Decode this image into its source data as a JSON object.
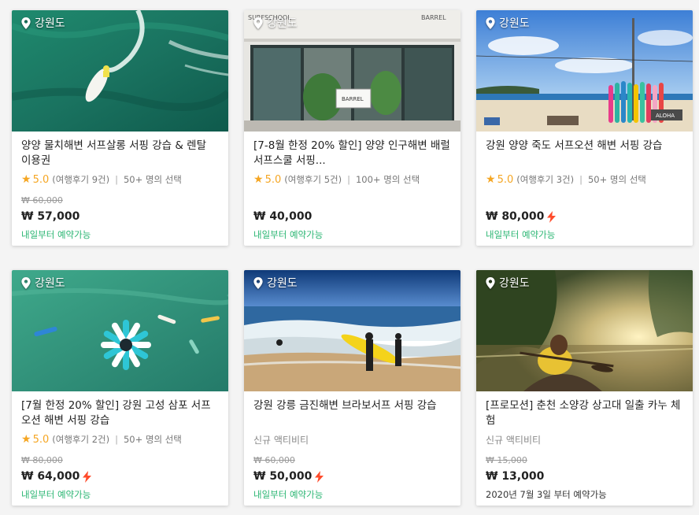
{
  "cards": [
    {
      "location": "강원도",
      "title": "양양 물치해변 서프살롱 서핑 강습 & 렌탈 이용권",
      "rating": "5.0",
      "reviews": "(여행후기 9건)",
      "popularity": "50+ 명의 선택",
      "original_price": "₩ 60,000",
      "price": "₩ 57,000",
      "lightning": false,
      "availability": "내일부터 예약가능",
      "availability_color": "#2bb673"
    },
    {
      "location": "강원도",
      "title": "[7-8월 한정 20% 할인] 양양 인구해변 배럴서프스쿨 서핑...",
      "rating": "5.0",
      "reviews": "(여행후기 5건)",
      "popularity": "100+ 명의 선택",
      "original_price": "",
      "price": "₩ 40,000",
      "lightning": false,
      "availability": "내일부터 예약가능",
      "availability_color": "#2bb673",
      "signs": [
        "SURFSCHOOL",
        "BARREL"
      ]
    },
    {
      "location": "강원도",
      "title": "강원 양양 죽도 서프오션 해변 서핑 강습",
      "rating": "5.0",
      "reviews": "(여행후기 3건)",
      "popularity": "50+ 명의 선택",
      "original_price": "",
      "price": "₩ 80,000",
      "lightning": true,
      "availability": "내일부터 예약가능",
      "availability_color": "#2bb673",
      "signs": [
        "ALOHA"
      ]
    },
    {
      "location": "강원도",
      "title": "[7월 한정 20% 할인] 강원 고성 삼포 서프오션 해변 서핑 강습",
      "rating": "5.0",
      "reviews": "(여행후기 2건)",
      "popularity": "50+ 명의 선택",
      "original_price": "₩ 80,000",
      "price": "₩ 64,000",
      "lightning": true,
      "availability": "내일부터 예약가능",
      "availability_color": "#2bb673"
    },
    {
      "location": "강원도",
      "title": "강원 강릉 금진해변 브라보서프 서핑 강습",
      "new_label": "신규 액티비티",
      "original_price": "₩ 60,000",
      "price": "₩ 50,000",
      "lightning": true,
      "availability": "내일부터 예약가능",
      "availability_color": "#2bb673"
    },
    {
      "location": "강원도",
      "title": "[프로모션] 춘천 소양강 상고대 일출 카누 체험",
      "new_label": "신규 액티비티",
      "original_price": "₩ 15,000",
      "price": "₩ 13,000",
      "lightning": false,
      "availability": "2020년 7월 3일 부터 예약가능",
      "availability_color": "#333333"
    }
  ],
  "icons": {
    "location": "map-pin-icon",
    "rating": "star-icon",
    "instant": "lightning-icon"
  },
  "colors": {
    "accent_green": "#2bb673",
    "star": "#f5a623",
    "lightning": "#ff4b2b"
  }
}
